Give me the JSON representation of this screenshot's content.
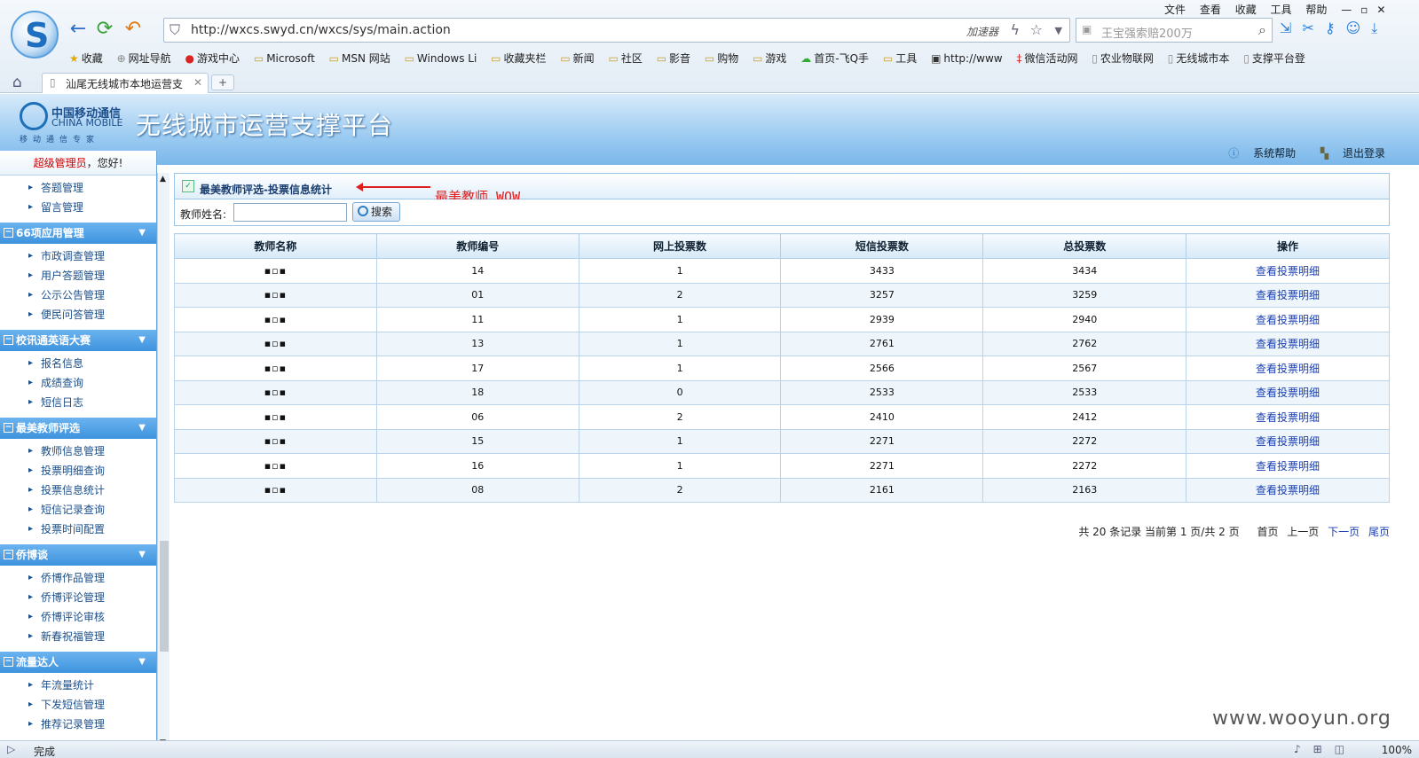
{
  "browser": {
    "url": "http://wxcs.swyd.cn/wxcs/sys/main.action",
    "accelerator": "加速器",
    "search_placeholder": "王宝强索赔200万",
    "menus": [
      "文件",
      "查看",
      "收藏",
      "工具",
      "帮助"
    ],
    "bookmarks": [
      "收藏",
      "网址导航",
      "游戏中心",
      "Microsoft",
      "MSN 网站",
      "Windows Li",
      "收藏夹栏",
      "新闻",
      "社区",
      "影音",
      "购物",
      "游戏",
      "首页-飞Q手",
      "工具",
      "http://www",
      "微信活动网",
      "农业物联网",
      "无线城市本",
      "支撑平台登"
    ],
    "tab_title": "汕尾无线城市本地运营支",
    "status": "完成",
    "zoom": "100%"
  },
  "header": {
    "logo_cn": "中国移动通信",
    "logo_en": "CHINA MOBILE",
    "logo_tag": "移动通信专家",
    "title": "无线城市运营支撑平台",
    "help": "系统帮助",
    "logout": "退出登录"
  },
  "sidebar": {
    "role": "超级管理员",
    "greeting": "，您好!",
    "top_items": [
      "答题管理",
      "留言管理"
    ],
    "groups": [
      {
        "title": "66项应用管理",
        "items": [
          "市政调查管理",
          "用户答题管理",
          "公示公告管理",
          "便民问答管理"
        ]
      },
      {
        "title": "校讯通英语大赛",
        "items": [
          "报名信息",
          "成绩查询",
          "短信日志"
        ]
      },
      {
        "title": "最美教师评选",
        "items": [
          "教师信息管理",
          "投票明细查询",
          "投票信息统计",
          "短信记录查询",
          "投票时间配置"
        ]
      },
      {
        "title": "侨博谈",
        "items": [
          "侨博作品管理",
          "侨博评论管理",
          "侨博评论审核",
          "新春祝福管理"
        ]
      },
      {
        "title": "流量达人",
        "items": [
          "年流量统计",
          "下发短信管理",
          "推荐记录管理"
        ]
      }
    ]
  },
  "panel": {
    "title": "最美教师评选-投票信息统计",
    "annotation": "最美教师 WOW",
    "search_label": "教师姓名:",
    "search_button": "搜索"
  },
  "table": {
    "headers": [
      "教师名称",
      "教师编号",
      "网上投票数",
      "短信投票数",
      "总投票数",
      "操作"
    ],
    "rows": [
      {
        "name": "▪︎▫︎▪︎",
        "id": "14",
        "online": "1",
        "sms": "3433",
        "total": "3434",
        "op": "查看投票明细"
      },
      {
        "name": "▪︎▫︎▪︎",
        "id": "01",
        "online": "2",
        "sms": "3257",
        "total": "3259",
        "op": "查看投票明细"
      },
      {
        "name": "▪︎▫︎▪︎",
        "id": "11",
        "online": "1",
        "sms": "2939",
        "total": "2940",
        "op": "查看投票明细"
      },
      {
        "name": "▪︎▫︎▪︎",
        "id": "13",
        "online": "1",
        "sms": "2761",
        "total": "2762",
        "op": "查看投票明细"
      },
      {
        "name": "▪︎▫︎▪︎",
        "id": "17",
        "online": "1",
        "sms": "2566",
        "total": "2567",
        "op": "查看投票明细"
      },
      {
        "name": "▪︎▫︎▪︎",
        "id": "18",
        "online": "0",
        "sms": "2533",
        "total": "2533",
        "op": "查看投票明细"
      },
      {
        "name": "▪︎▫︎▪︎",
        "id": "06",
        "online": "2",
        "sms": "2410",
        "total": "2412",
        "op": "查看投票明细"
      },
      {
        "name": "▪︎▫︎▪︎",
        "id": "15",
        "online": "1",
        "sms": "2271",
        "total": "2272",
        "op": "查看投票明细"
      },
      {
        "name": "▪︎▫︎▪︎",
        "id": "16",
        "online": "1",
        "sms": "2271",
        "total": "2272",
        "op": "查看投票明细"
      },
      {
        "name": "▪︎▫︎▪︎",
        "id": "08",
        "online": "2",
        "sms": "2161",
        "total": "2163",
        "op": "查看投票明细"
      }
    ]
  },
  "pager": {
    "summary": "共 20 条记录 当前第 1 页/共 2 页",
    "first": "首页",
    "prev": "上一页",
    "next": "下一页",
    "last": "尾页"
  },
  "watermark": "www.wooyun.org"
}
